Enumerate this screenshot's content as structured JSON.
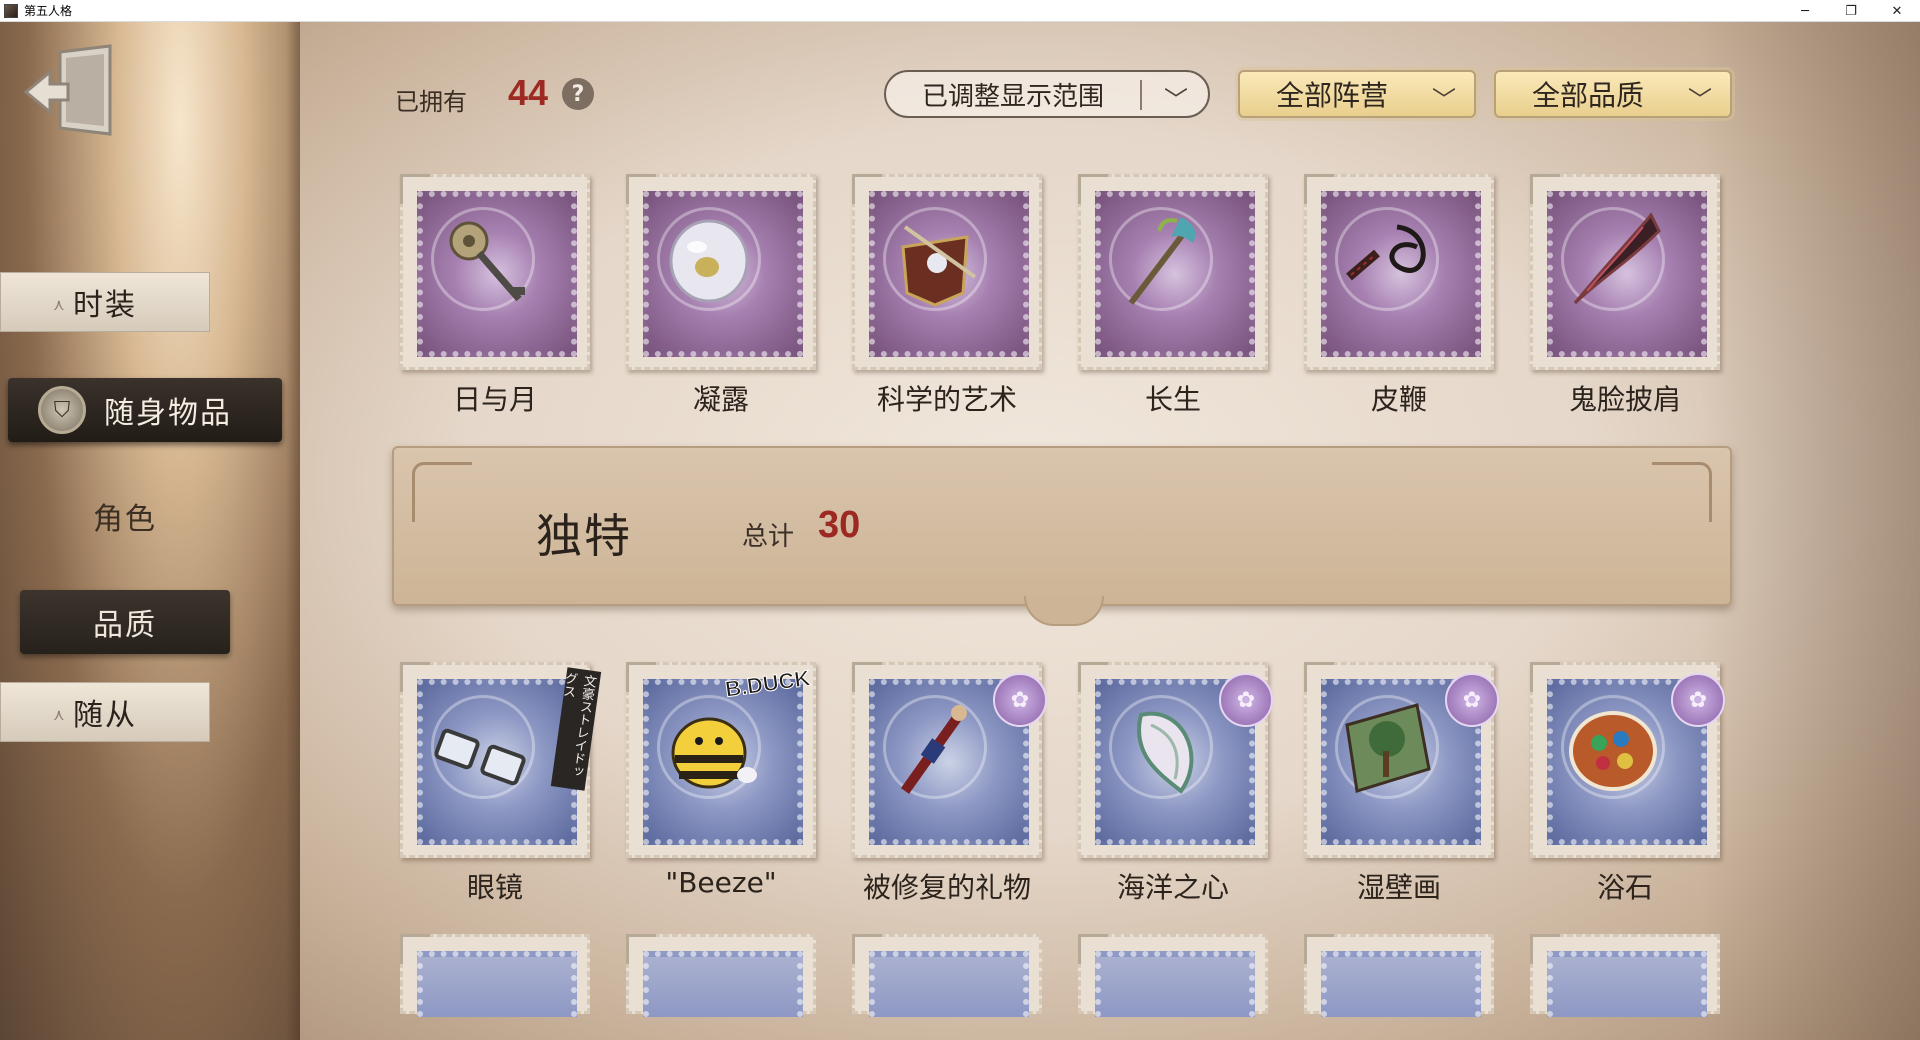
{
  "window": {
    "title": "第五人格",
    "minimize": "─",
    "restore": "❐",
    "close": "✕"
  },
  "sidebar": {
    "items": [
      {
        "label": "时装",
        "state": "collapsed"
      },
      {
        "label": "随身物品",
        "state": "active"
      },
      {
        "label": "角色",
        "state": "plain"
      },
      {
        "label": "品质",
        "state": "selected"
      },
      {
        "label": "随从",
        "state": "collapsed"
      }
    ],
    "collapse_glyph": "⋏",
    "exit_icon": "exit-door-icon"
  },
  "header": {
    "owned_label": "已拥有",
    "owned_count": "44",
    "help_glyph": "?",
    "range_filter": "已调整显示范围",
    "camp_filter": "全部阵营",
    "quality_filter": "全部品质",
    "chevron_glyph": "﹀"
  },
  "top_items": [
    {
      "name": "日与月",
      "frame": "purple",
      "icon": "key-scepter-icon"
    },
    {
      "name": "凝露",
      "frame": "purple",
      "icon": "dew-orb-icon"
    },
    {
      "name": "科学的艺术",
      "frame": "purple",
      "icon": "sword-shield-icon"
    },
    {
      "name": "长生",
      "frame": "purple",
      "icon": "staff-icon"
    },
    {
      "name": "皮鞭",
      "frame": "purple",
      "icon": "whip-icon"
    },
    {
      "name": "鬼脸披肩",
      "frame": "purple",
      "icon": "shawl-icon"
    }
  ],
  "section": {
    "title": "独特",
    "total_label": "总计",
    "total_count": "30"
  },
  "unique_items": [
    {
      "name": "眼镜",
      "frame": "blue",
      "icon": "glasses-icon",
      "sticker": "文豪ストレイドッグス"
    },
    {
      "name": "\"Beeze\"",
      "frame": "blue",
      "icon": "bee-plush-icon",
      "logo": "B.DUCK"
    },
    {
      "name": "被修复的礼物",
      "frame": "blue",
      "icon": "nutcracker-icon",
      "badge": "✿"
    },
    {
      "name": "海洋之心",
      "frame": "blue",
      "icon": "seashell-icon",
      "badge": "✿"
    },
    {
      "name": "湿壁画",
      "frame": "blue",
      "icon": "fresco-icon",
      "badge": "✿"
    },
    {
      "name": "浴石",
      "frame": "blue",
      "icon": "bath-stone-icon",
      "badge": "✿"
    }
  ],
  "colors": {
    "accent_red": "#9d2a22",
    "gold_dropdown": "#e9cf8e",
    "purple_frame": "#7a557e",
    "blue_frame": "#5e6b9f"
  }
}
